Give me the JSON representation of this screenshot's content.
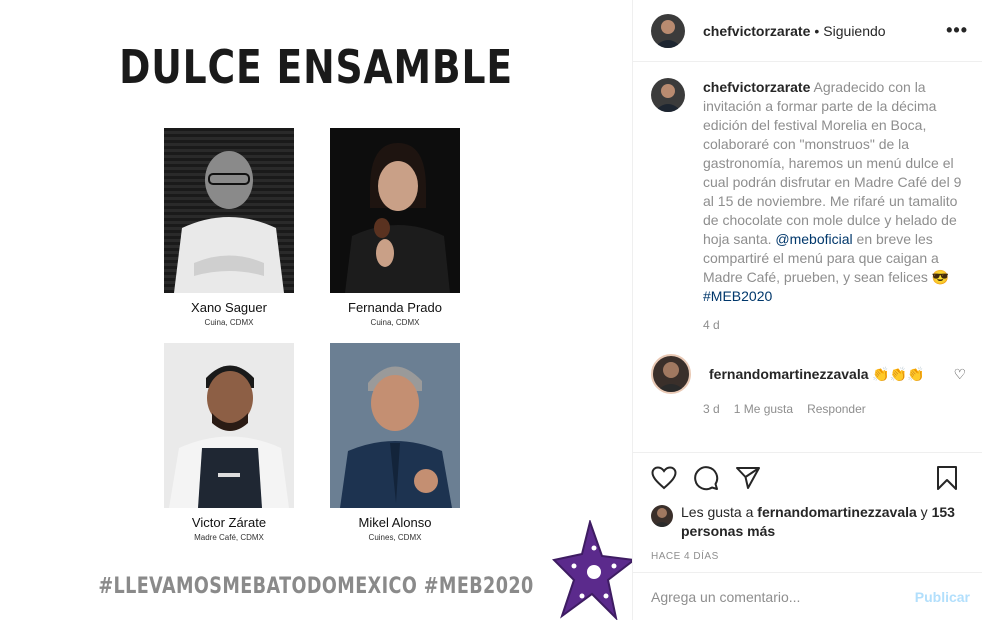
{
  "poster": {
    "title": "DULCE ENSAMBLE",
    "hashtags": "#LLEVAMOSMEBATODOMEXICO  #MEB2020",
    "chefs": [
      {
        "name": "Xano Saguer",
        "city": "Cuina, CDMX"
      },
      {
        "name": "Fernanda Prado",
        "city": "Cuina, CDMX"
      },
      {
        "name": "Victor Zárate",
        "city": "Madre Café, CDMX"
      },
      {
        "name": "Mikel Alonso",
        "city": "Cuines, CDMX"
      }
    ]
  },
  "header": {
    "username": "chefvictorzarate",
    "separator": "•",
    "follow_status": "Siguiendo",
    "more": "•••"
  },
  "caption": {
    "username": "chefvictorzarate",
    "text_1": "Agradecido con la invitación a formar parte de la décima edición del festival Morelia en Boca, colaboraré con \"monstruos\" de la gastronomía, haremos un menú dulce el cual podrán disfrutar en Madre Café del 9 al 15 de noviembre. Me rifaré un tamalito de chocolate con mole dulce y helado de hoja santa.",
    "mention": "@meboficial",
    "text_2": "en breve les compartiré el menú para que caigan a Madre Café, prueben, y sean felices 😎",
    "hashtag": "#MEB2020",
    "age": "4 d"
  },
  "comment": {
    "username": "fernandomartinezzavala",
    "emojis": "👏👏👏",
    "age": "3 d",
    "likes": "1 Me gusta",
    "reply": "Responder"
  },
  "likes": {
    "prefix": "Les gusta a",
    "user": "fernandomartinezzavala",
    "conj": "y",
    "others": "153 personas más"
  },
  "date": "HACE 4 DÍAS",
  "add_comment": {
    "placeholder": "Agrega un comentario...",
    "publish": "Publicar"
  },
  "colors": {
    "text": "#262626",
    "muted": "#8e8e8e",
    "link": "#00376b",
    "publish_disabled": "#b2dffc",
    "border": "#efefef"
  },
  "icons": [
    "more-icon",
    "heart-icon",
    "comment-icon",
    "share-icon",
    "bookmark-icon",
    "small-heart-icon"
  ]
}
